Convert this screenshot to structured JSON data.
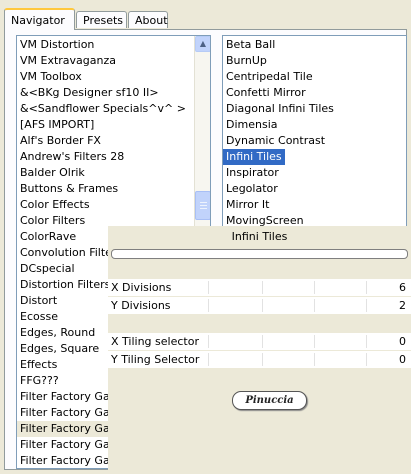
{
  "tabs": {
    "navigator": "Navigator",
    "presets": "Presets",
    "about": "About"
  },
  "categories": [
    "VM Distortion",
    "VM Extravaganza",
    "VM Toolbox",
    "&<BKg Designer sf10 II>",
    "&<Sandflower Specials^v^ >",
    "[AFS IMPORT]",
    "Alf's Border FX",
    "Andrew's Filters 28",
    "Balder Olrik",
    "Buttons & Frames",
    "Color Effects",
    "Color Filters",
    "ColorRave",
    "Convolution Filters",
    "DCspecial",
    "Distortion Filters",
    "Distort",
    "Ecosse",
    "Edges, Round",
    "Edges, Square",
    "Effects",
    "FFG???",
    "Filter Factory Gallery A",
    "Filter Factory Gallery C",
    "Filter Factory Gallery D",
    "Filter Factory Gallery G",
    "Filter Factory Gallery H"
  ],
  "filters": [
    "Beta Ball",
    "BurnUp",
    "Centripedal Tile",
    "Confetti Mirror",
    "Diagonal Infini Tiles",
    "Dimensia",
    "Dynamic Contrast",
    "Infini Tiles",
    "Inspirator",
    "Legolator",
    "Mirror It",
    "MovingScreen"
  ],
  "selected_category": "Filter Factory Gallery D",
  "selected_filter": "Infini Tiles",
  "settings": {
    "title": "Infini Tiles",
    "params": [
      {
        "label": "X Divisions",
        "value": "6"
      },
      {
        "label": "Y Divisions",
        "value": "2"
      },
      {
        "label": "X Tiling selector",
        "value": "0"
      },
      {
        "label": "Y Tiling Selector",
        "value": "0"
      }
    ]
  },
  "logo_text": "Pinuccia",
  "colors": {
    "selection": "#316ac5",
    "tab_accent": "#ffc83c",
    "window_bg": "#ece9d8"
  }
}
